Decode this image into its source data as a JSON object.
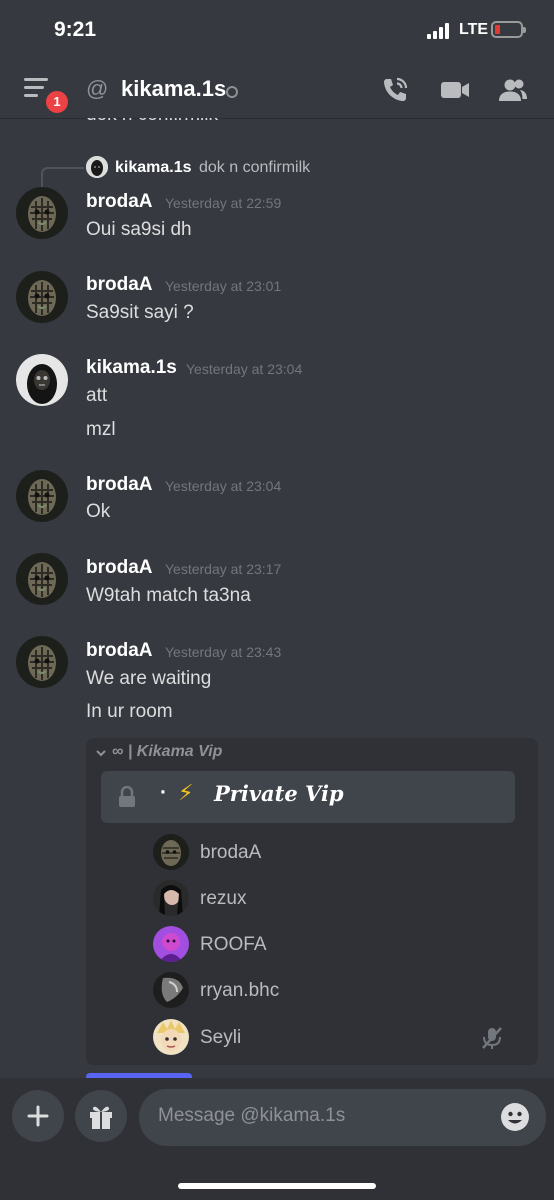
{
  "status_bar": {
    "time": "9:21",
    "network": "LTE"
  },
  "header": {
    "notification_count": "1",
    "at_symbol": "@",
    "title": "kikama.1s"
  },
  "clipped_text": "dok n confirmilk",
  "reply": {
    "username": "kikama.1s",
    "text": "dok n confirmilk"
  },
  "messages": [
    {
      "username": "brodaA",
      "timestamp": "Yesterday at 22:59",
      "lines": [
        "Oui sa9si dh"
      ]
    },
    {
      "username": "brodaA",
      "timestamp": "Yesterday at 23:01",
      "lines": [
        "Sa9sit sayi ?"
      ]
    },
    {
      "username": "kikama.1s",
      "timestamp": "Yesterday at 23:04",
      "lines": [
        "att",
        "mzl"
      ]
    },
    {
      "username": "brodaA",
      "timestamp": "Yesterday at 23:04",
      "lines": [
        "Ok"
      ]
    },
    {
      "username": "brodaA",
      "timestamp": "Yesterday at 23:17",
      "lines": [
        "W9tah match ta3na"
      ]
    },
    {
      "username": "brodaA",
      "timestamp": "Yesterday at 23:43",
      "lines": [
        "We are waiting",
        "In ur room"
      ]
    }
  ],
  "embed": {
    "server_name": "∞ | Kikama Vip",
    "channel_prefix": "·",
    "channel_emoji": "⚡",
    "channel_name": "Private Vip",
    "members": [
      {
        "name": "brodaA"
      },
      {
        "name": "rezux"
      },
      {
        "name": "ROOFA"
      },
      {
        "name": "rryan.bhc"
      },
      {
        "name": "Seyli"
      }
    ]
  },
  "composer": {
    "placeholder": "Message @kikama.1s"
  },
  "colors": {
    "background": "#36393f",
    "badge": "#ed4245",
    "embed": "#2f3136",
    "blurple": "#5865f2"
  }
}
